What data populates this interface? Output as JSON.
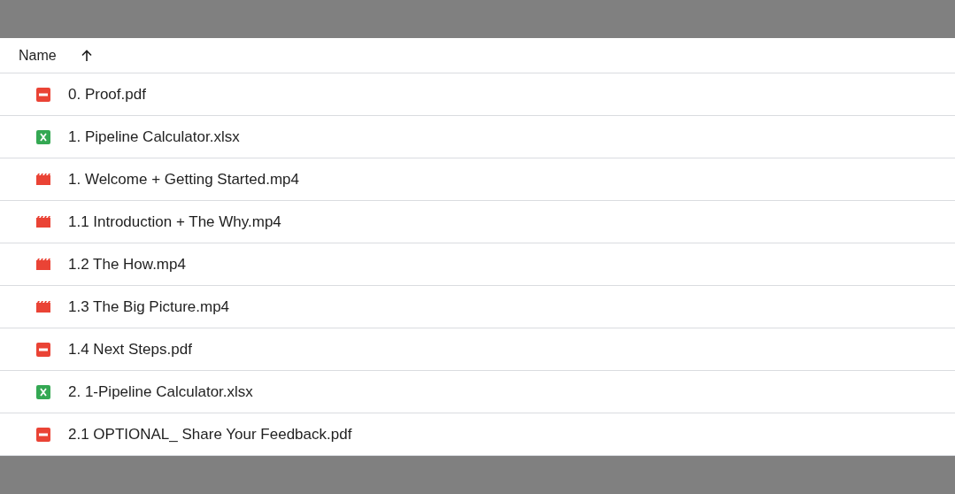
{
  "table": {
    "columns": [
      {
        "label": "Name",
        "sort_ascending": true
      }
    ],
    "rows": [
      {
        "kind": "pdf",
        "name": "0. Proof.pdf"
      },
      {
        "kind": "sheet",
        "name": "1. Pipeline Calculator.xlsx"
      },
      {
        "kind": "video",
        "name": "1. Welcome + Getting Started.mp4"
      },
      {
        "kind": "video",
        "name": "1.1 Introduction + The Why.mp4"
      },
      {
        "kind": "video",
        "name": "1.2 The How.mp4"
      },
      {
        "kind": "video",
        "name": "1.3 The Big Picture.mp4"
      },
      {
        "kind": "pdf",
        "name": "1.4 Next Steps.pdf"
      },
      {
        "kind": "sheet",
        "name": "2. 1-Pipeline Calculator.xlsx"
      },
      {
        "kind": "pdf",
        "name": "2.1 OPTIONAL_ Share Your Feedback.pdf"
      }
    ]
  }
}
